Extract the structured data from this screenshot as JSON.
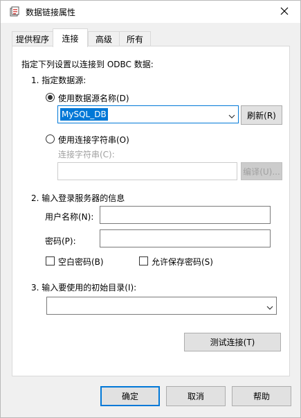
{
  "window": {
    "title": "数据链接属性",
    "icon": "data-link-icon",
    "close_icon": "close-icon"
  },
  "tabs": [
    {
      "label": "提供程序",
      "active": false
    },
    {
      "label": "连接",
      "active": true
    },
    {
      "label": "高级",
      "active": false
    },
    {
      "label": "所有",
      "active": false
    }
  ],
  "connection": {
    "intro": "指定下列设置以连接到 ODBC 数据:",
    "step1": "1. 指定数据源:",
    "use_dsn_label": "使用数据源名称(D)",
    "use_dsn_selected": true,
    "dsn_value": "MySQL_DB",
    "refresh_label": "刷新(R)",
    "use_connstr_label": "使用连接字符串(O)",
    "connstr_label": "连接字符串(C):",
    "connstr_value": "",
    "compile_label": "编译(U)...",
    "step2": "2. 输入登录服务器的信息",
    "username_label": "用户名称(N):",
    "username_value": "",
    "password_label": "密码(P):",
    "password_value": "",
    "blank_password_label": "空白密码(B)",
    "blank_password_checked": false,
    "allow_save_password_label": "允许保存密码(S)",
    "allow_save_password_checked": false,
    "step3": "3. 输入要使用的初始目录(I):",
    "initial_catalog_value": "",
    "test_connection_label": "测试连接(T)"
  },
  "footer": {
    "ok_label": "确定",
    "cancel_label": "取消",
    "help_label": "帮助"
  },
  "colors": {
    "accent": "#0078d7",
    "disabled_text": "#a0a0a0"
  }
}
